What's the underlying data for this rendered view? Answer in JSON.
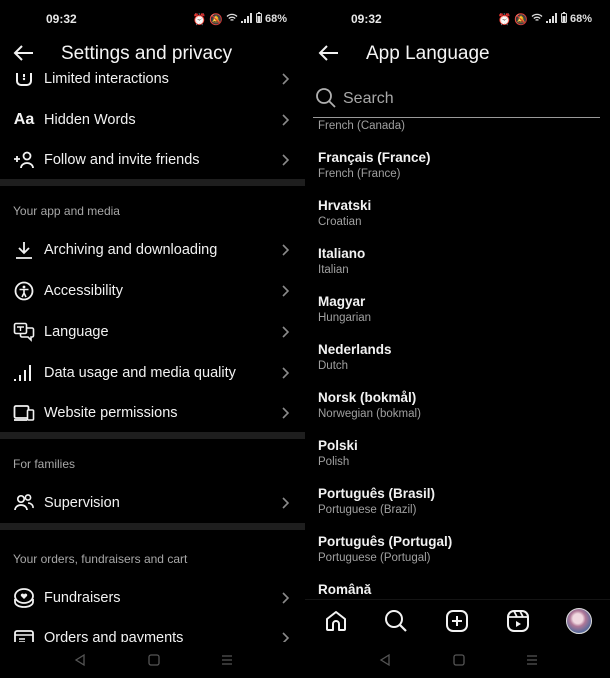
{
  "status_bar": {
    "time": "09:32",
    "battery": "68%",
    "icons": [
      "alarm-icon",
      "mute-icon",
      "wifi-icon",
      "signal-icon",
      "battery-icon"
    ]
  },
  "left": {
    "header": {
      "title": "Settings and privacy",
      "back_icon": "arrow-left-icon"
    },
    "rows_top": [
      {
        "label": "Limited interactions",
        "icon": "limited-interactions-icon"
      },
      {
        "label": "Hidden Words",
        "icon": "text-aa-icon"
      },
      {
        "label": "Follow and invite friends",
        "icon": "add-person-icon"
      }
    ],
    "sections": [
      {
        "title": "Your app and media",
        "items": [
          {
            "label": "Archiving and downloading",
            "icon": "download-icon"
          },
          {
            "label": "Accessibility",
            "icon": "accessibility-icon"
          },
          {
            "label": "Language",
            "icon": "language-icon"
          },
          {
            "label": "Data usage and media quality",
            "icon": "signal-bars-icon"
          },
          {
            "label": "Website permissions",
            "icon": "devices-icon"
          }
        ]
      },
      {
        "title": "For families",
        "items": [
          {
            "label": "Supervision",
            "icon": "people-icon"
          }
        ]
      },
      {
        "title": "Your orders, fundraisers and cart",
        "items": [
          {
            "label": "Fundraisers",
            "icon": "fundraiser-icon"
          },
          {
            "label": "Orders and payments",
            "icon": "receipt-icon"
          }
        ]
      }
    ]
  },
  "right": {
    "header": {
      "title": "App Language",
      "back_icon": "arrow-left-icon"
    },
    "search": {
      "placeholder": "Search",
      "value": ""
    },
    "partial_top": "French (Canada)",
    "languages": [
      {
        "native": "Français (France)",
        "english": "French (France)"
      },
      {
        "native": "Hrvatski",
        "english": "Croatian"
      },
      {
        "native": "Italiano",
        "english": "Italian"
      },
      {
        "native": "Magyar",
        "english": "Hungarian"
      },
      {
        "native": "Nederlands",
        "english": "Dutch"
      },
      {
        "native": "Norsk (bokmål)",
        "english": "Norwegian (bokmal)"
      },
      {
        "native": "Polski",
        "english": "Polish"
      },
      {
        "native": "Português (Brasil)",
        "english": "Portuguese (Brazil)"
      },
      {
        "native": "Português (Portugal)",
        "english": "Portuguese (Portugal)"
      },
      {
        "native": "Română",
        "english": ""
      }
    ],
    "tabbar": [
      "home-icon",
      "search-icon",
      "create-icon",
      "reels-icon",
      "profile-avatar"
    ]
  },
  "system_nav": [
    "back-triangle-icon",
    "home-square-icon",
    "recents-icon"
  ]
}
